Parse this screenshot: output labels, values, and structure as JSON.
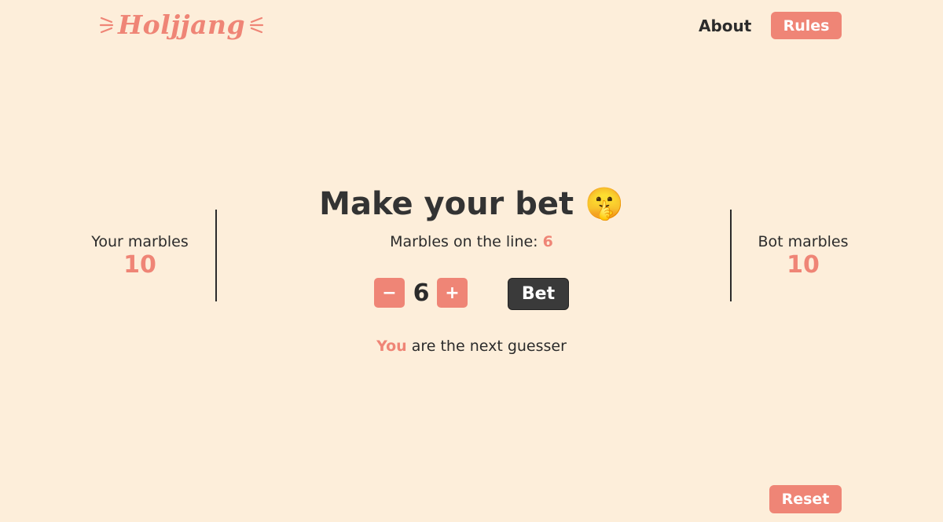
{
  "header": {
    "logo_text": "Holjjang",
    "nav": {
      "about_label": "About",
      "rules_label": "Rules"
    }
  },
  "player": {
    "label": "Your marbles",
    "count": "10"
  },
  "bot": {
    "label": "Bot marbles",
    "count": "10"
  },
  "main": {
    "title": "Make your bet",
    "title_emoji": "🤫",
    "on_line_label": "Marbles on the line:",
    "on_line_value": "6",
    "stepper": {
      "minus_label": "−",
      "value": "6",
      "plus_label": "+"
    },
    "bet_label": "Bet",
    "guesser_who": "You",
    "guesser_text": "are the next guesser"
  },
  "footer": {
    "reset_label": "Reset"
  },
  "colors": {
    "background": "#FDEEDA",
    "accent": "#EF8576",
    "dark": "#3a3a3a"
  }
}
